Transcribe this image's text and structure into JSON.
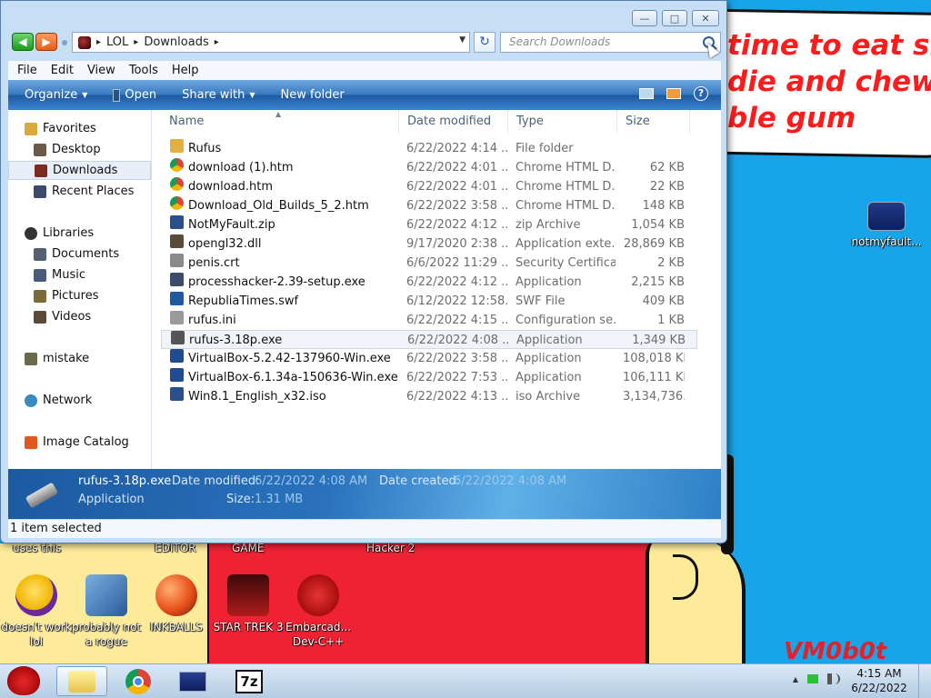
{
  "desktop": {
    "wallpaper_text": [
      "time to eat shit",
      "die and chew",
      "ble gum"
    ],
    "signature": "VM0b0t",
    "icons": [
      {
        "label": "notmyfault..."
      },
      {
        "label": "doesn't work lol"
      },
      {
        "label": "probably not a rogue"
      },
      {
        "label": "INKBALLS"
      },
      {
        "label": "STAR TREK 3"
      },
      {
        "label": "Embarcad... Dev-C++"
      }
    ],
    "cut_labels": [
      "uses this",
      "EDITOR",
      "GAME",
      "Hacker 2"
    ]
  },
  "window": {
    "caption_buttons": {
      "minimize": "—",
      "maximize": "□",
      "close": "✕"
    },
    "nav": {
      "back_arrow": "◀",
      "forward_arrow": "▶"
    },
    "address": {
      "segments": [
        "LOL",
        "Downloads"
      ],
      "separator": "▸",
      "dropdown": "▼"
    },
    "refresh": "↻",
    "search": {
      "placeholder": "Search Downloads"
    },
    "menu": [
      "File",
      "Edit",
      "View",
      "Tools",
      "Help"
    ],
    "toolbar": {
      "organize": "Organize",
      "open": "Open",
      "share": "Share with",
      "new_folder": "New folder",
      "help": "?"
    },
    "nav_pane": [
      {
        "label": "Favorites",
        "icon": "star-icon",
        "color": "#d9a93b"
      },
      {
        "label": "Desktop",
        "icon": "desktop-icon",
        "color": "#6b5a4a"
      },
      {
        "label": "Downloads",
        "icon": "downloads-icon",
        "color": "#7a2d1e"
      },
      {
        "label": "Recent Places",
        "icon": "recent-places-icon",
        "color": "#3b4a6b"
      },
      {
        "label": "Libraries",
        "icon": "libraries-icon",
        "color": "#333333"
      },
      {
        "label": "Documents",
        "icon": "documents-icon",
        "color": "#55606e"
      },
      {
        "label": "Music",
        "icon": "music-icon",
        "color": "#4a5a7a"
      },
      {
        "label": "Pictures",
        "icon": "pictures-icon",
        "color": "#7b6a3a"
      },
      {
        "label": "Videos",
        "icon": "videos-icon",
        "color": "#5b4a3a"
      },
      {
        "label": "mistake",
        "icon": "homegroup-icon",
        "color": "#6a6a4a"
      },
      {
        "label": "Network",
        "icon": "network-icon",
        "color": "#3a8ac0"
      },
      {
        "label": "Image Catalog",
        "icon": "image-catalog-icon",
        "color": "#e05a20"
      }
    ],
    "columns": {
      "name": "Name",
      "date": "Date modified",
      "type": "Type",
      "size": "Size"
    },
    "files": [
      {
        "name": "Rufus",
        "date": "6/22/2022 4:14 ...",
        "type": "File folder",
        "size": "",
        "icon": "folder-icon",
        "color": "#e0b040"
      },
      {
        "name": "download (1).htm",
        "date": "6/22/2022 4:01 ...",
        "type": "Chrome HTML D...",
        "size": "62 KB",
        "icon": "chrome-icon",
        "color": "#db4437"
      },
      {
        "name": "download.htm",
        "date": "6/22/2022 4:01 ...",
        "type": "Chrome HTML D...",
        "size": "22 KB",
        "icon": "chrome-icon",
        "color": "#db4437"
      },
      {
        "name": "Download_Old_Builds_5_2.htm",
        "date": "6/22/2022 3:58 ...",
        "type": "Chrome HTML D...",
        "size": "148 KB",
        "icon": "chrome-icon",
        "color": "#db4437"
      },
      {
        "name": "NotMyFault.zip",
        "date": "6/22/2022 4:12 ...",
        "type": "zip Archive",
        "size": "1,054 KB",
        "icon": "zip-icon",
        "color": "#2a4f8a"
      },
      {
        "name": "opengl32.dll",
        "date": "9/17/2020 2:38 ...",
        "type": "Application exte...",
        "size": "28,869 KB",
        "icon": "dll-icon",
        "color": "#5a4a3a"
      },
      {
        "name": "penis.crt",
        "date": "6/6/2022 11:29 ...",
        "type": "Security Certifica...",
        "size": "2 KB",
        "icon": "certificate-icon",
        "color": "#8a8a8a"
      },
      {
        "name": "processhacker-2.39-setup.exe",
        "date": "6/22/2022 4:12 ...",
        "type": "Application",
        "size": "2,215 KB",
        "icon": "setup-icon",
        "color": "#3a4a6a"
      },
      {
        "name": "RepubliaTimes.swf",
        "date": "6/12/2022 12:58...",
        "type": "SWF File",
        "size": "409 KB",
        "icon": "swf-icon",
        "color": "#1f5aa0"
      },
      {
        "name": "rufus.ini",
        "date": "6/22/2022 4:15 ...",
        "type": "Configuration se...",
        "size": "1 KB",
        "icon": "ini-icon",
        "color": "#9a9a9a"
      },
      {
        "name": "rufus-3.18p.exe",
        "date": "6/22/2022 4:08 ...",
        "type": "Application",
        "size": "1,349 KB",
        "icon": "usb-drive-icon",
        "color": "#555555"
      },
      {
        "name": "VirtualBox-5.2.42-137960-Win.exe",
        "date": "6/22/2022 3:58 ...",
        "type": "Application",
        "size": "108,018 KB",
        "icon": "virtualbox-icon",
        "color": "#1e4c8e"
      },
      {
        "name": "VirtualBox-6.1.34a-150636-Win.exe",
        "date": "6/22/2022 7:53 ...",
        "type": "Application",
        "size": "106,111 KB",
        "icon": "virtualbox-icon",
        "color": "#1e4c8e"
      },
      {
        "name": "Win8.1_English_x32.iso",
        "date": "6/22/2022 4:13 ...",
        "type": "iso Archive",
        "size": "3,134,736...",
        "icon": "iso-icon",
        "color": "#2a4f8a"
      }
    ],
    "details": {
      "name": "rufus-3.18p.exe",
      "type": "Application",
      "modified_label": "Date modified:",
      "modified_value": "6/22/2022 4:08 AM",
      "created_label": "Date created:",
      "created_value": "6/22/2022 4:08 AM",
      "size_label": "Size:",
      "size_value": "1.31 MB"
    },
    "status": "1 item selected"
  },
  "taskbar": {
    "clock_time": "4:15 AM",
    "clock_date": "6/22/2022",
    "app_7z": "7z",
    "tray_arrow": "▲"
  }
}
